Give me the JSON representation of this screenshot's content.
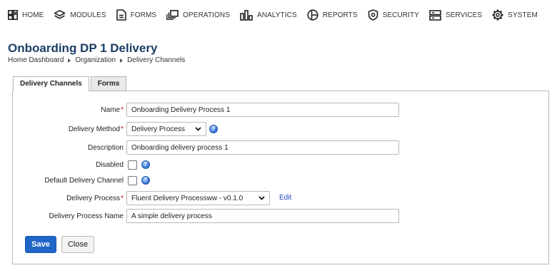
{
  "nav": {
    "items": [
      {
        "label": "HOME",
        "icon": "home-grid-icon"
      },
      {
        "label": "MODULES",
        "icon": "modules-diamond-icon"
      },
      {
        "label": "FORMS",
        "icon": "forms-document-icon"
      },
      {
        "label": "OPERATIONS",
        "icon": "operations-windows-icon"
      },
      {
        "label": "ANALYTICS",
        "icon": "analytics-bars-icon"
      },
      {
        "label": "REPORTS",
        "icon": "reports-circle-icon"
      },
      {
        "label": "SECURITY",
        "icon": "security-shield-icon"
      },
      {
        "label": "SERVICES",
        "icon": "services-server-icon"
      },
      {
        "label": "SYSTEM",
        "icon": "system-gear-icon"
      }
    ]
  },
  "page": {
    "title": "Onboarding DP 1 Delivery",
    "breadcrumb": [
      "Home Dashboard",
      "Organization",
      "Delivery Channels"
    ]
  },
  "tabs": [
    {
      "label": "Delivery Channels",
      "active": true
    },
    {
      "label": "Forms",
      "active": false
    }
  ],
  "form": {
    "name": {
      "label": "Name",
      "required": true,
      "value": "Onboarding Delivery Process 1"
    },
    "delivery_method": {
      "label": "Delivery Method",
      "required": true,
      "value": "Delivery Process"
    },
    "description": {
      "label": "Description",
      "value": "Onboarding delivery process 1"
    },
    "disabled": {
      "label": "Disabled",
      "checked": false
    },
    "default_channel": {
      "label": "Default Delivery Channel",
      "checked": false
    },
    "delivery_process": {
      "label": "Delivery Process",
      "required": true,
      "value": "Fluent Delivery Processww - v0.1.0",
      "edit_label": "Edit"
    },
    "delivery_process_name": {
      "label": "Delivery Process Name",
      "value": "A simple delivery process"
    }
  },
  "buttons": {
    "save": "Save",
    "close": "Close"
  },
  "colors": {
    "accent": "#1f66c9",
    "title": "#1c3e66",
    "required": "#cc0000",
    "link": "#1a3fbf"
  }
}
